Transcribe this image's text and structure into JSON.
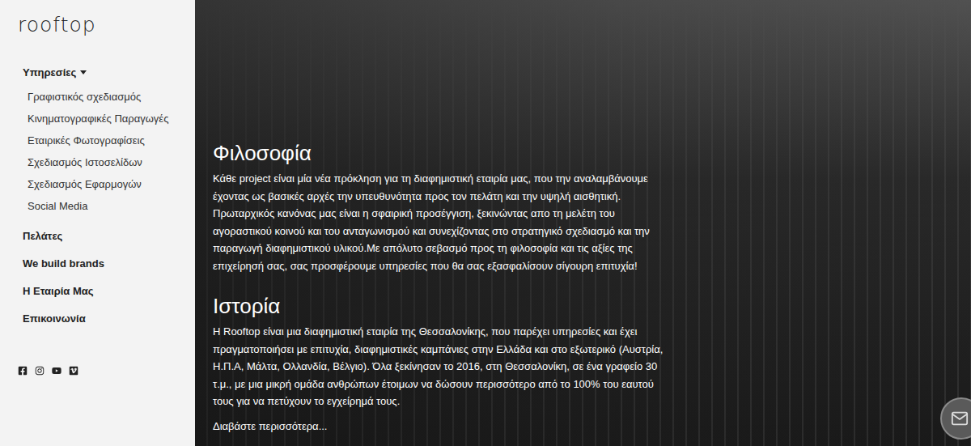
{
  "logo": {
    "text": "rooftop"
  },
  "sidebar": {
    "items": [
      {
        "label": "Υπηρεσίες",
        "expanded": true,
        "children": [
          "Γραφιστικός σχεδιασμός",
          "Κινηματογραφικές Παραγωγές",
          "Εταιρικές Φωτογραφίσεις",
          "Σχεδιασμός Ιστοσελίδων",
          "Σχεδιασμός Εφαρμογών",
          "Social Media"
        ]
      },
      {
        "label": "Πελάτες",
        "expanded": false,
        "children": []
      },
      {
        "label": "We build brands",
        "expanded": false,
        "children": []
      },
      {
        "label": "Η Εταιρία Μας",
        "expanded": false,
        "children": []
      },
      {
        "label": "Επικοινωνία",
        "expanded": false,
        "children": []
      }
    ]
  },
  "sections": [
    {
      "title": "Φιλοσοφία",
      "text": "Κάθε project είναι μία νέα πρόκληση για τη διαφημιστική εταιρία μας, που την αναλαμβάνουμε έχοντας ως βασικές αρχές την υπευθυνότητα προς τον πελάτη και την υψηλή αισθητική. Πρωταρχικός κανόνας μας είναι η σφαιρική προσέγγιση, ξεκινώντας απο τη μελέτη του αγοραστικού κοινού και του ανταγωνισμού και συνεχίζοντας στο στρατηγικό σχεδιασμό και την παραγωγή διαφημιστικού υλικού.Με απόλυτο σεβασμό προς τη φιλοσοφία και τις αξίες της επιχείρησή σας, σας προσφέρουμε υπηρεσίες που θα σας εξασφαλίσουν σίγουρη επιτυχία!"
    },
    {
      "title": "Ιστορία",
      "text": "Η Rooftop είναι μια διαφημιστική εταιρία της Θεσσαλονίκης, που παρέχει υπηρεσίες και έχει πραγματοποιήσει με επιτυχία, διαφημιστικές καμπάνιες στην Ελλάδα και στο εξωτερικό (Αυστρία, Η.Π.Α, Μάλτα, Ολλανδία, Βέλγιο). Όλα ξεκίνησαν το 2016, στη Θεσσαλονίκη, σε ένα γραφείο 30 τ.μ., με μια μικρή ομάδα ανθρώπων έτοιμων να δώσουν περισσότερο από το 100% του εαυτού τους για να πετύχουν το εγχείρημά τους."
    }
  ],
  "read_more": "Διαβάστε περισσότερα..."
}
